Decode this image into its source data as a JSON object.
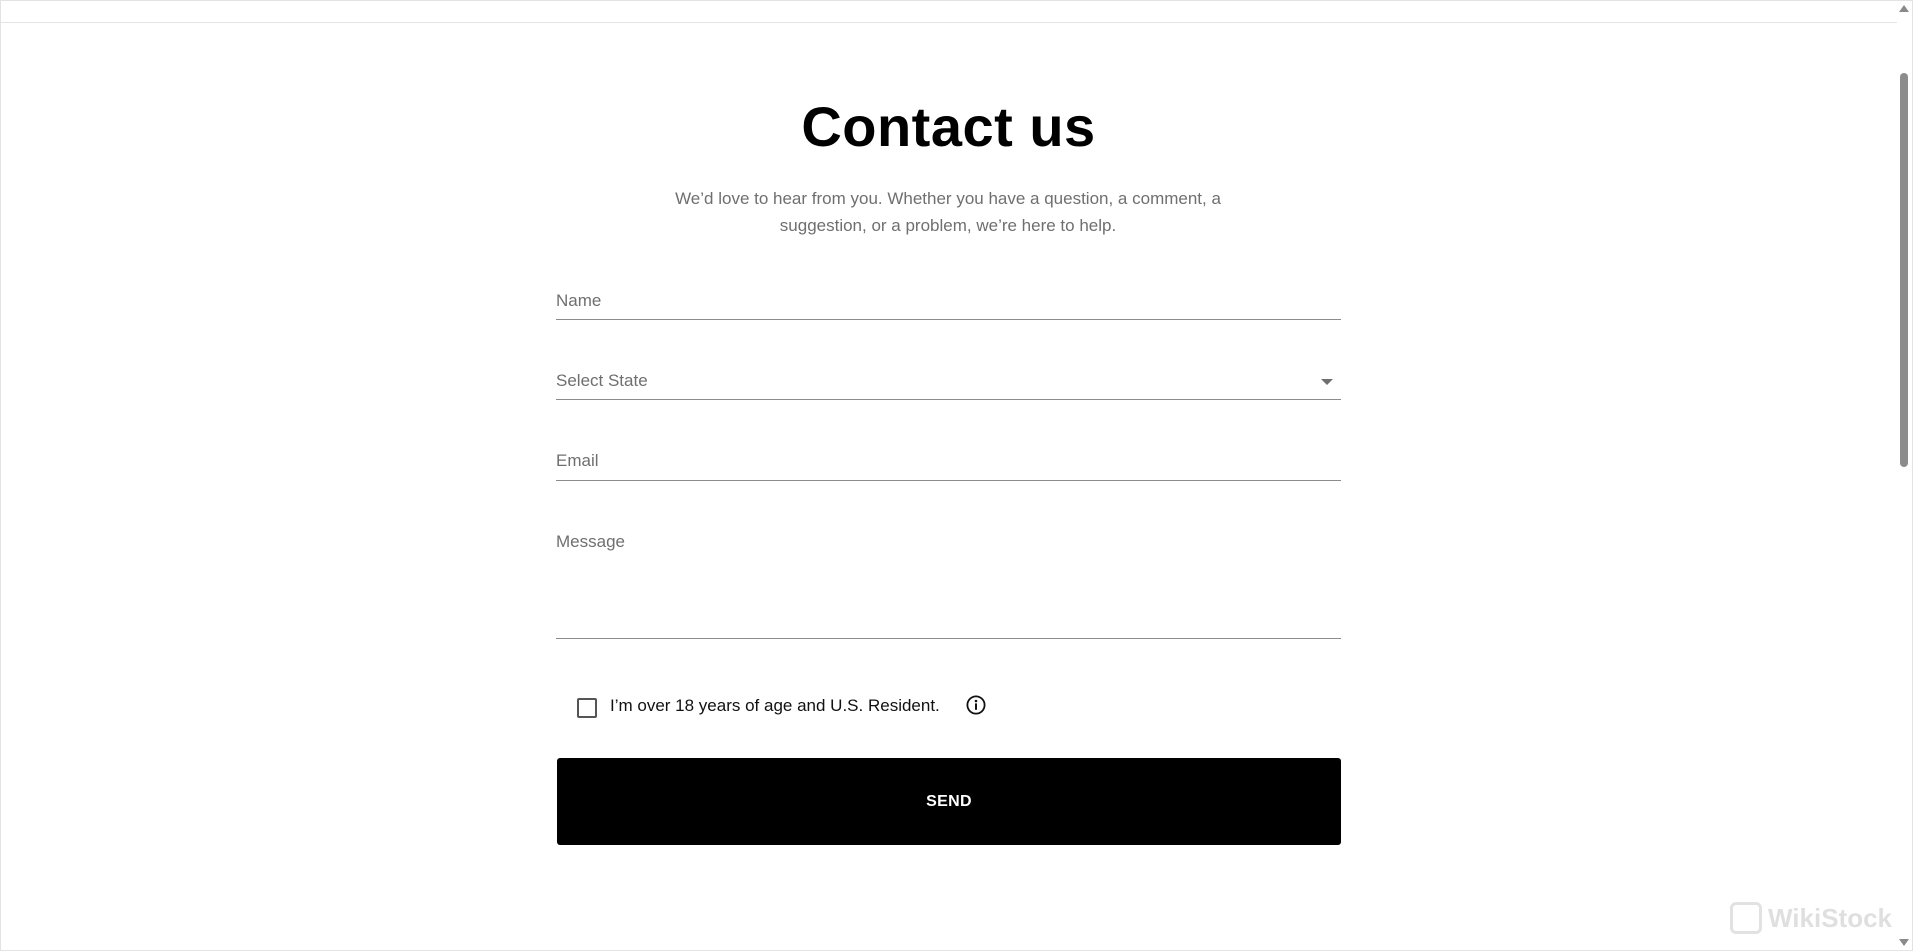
{
  "page": {
    "title": "Contact us",
    "subtitle": "We’d love to hear from you. Whether you have a question, a comment, a suggestion, or a problem, we’re here to help."
  },
  "form": {
    "name_placeholder": "Name",
    "state_placeholder": "Select State",
    "email_placeholder": "Email",
    "message_placeholder": "Message",
    "agree_label": "I’m over 18 years of age and U.S. Resident.",
    "agree_checked": false,
    "send_label": "SEND"
  },
  "watermark": {
    "text": "WikiStock"
  },
  "colors": {
    "accent": "#000000",
    "muted_text": "#6f6f6f",
    "underline": "#8b8b8b"
  },
  "icons": {
    "dropdown": "chevron-down-icon",
    "info": "info-icon",
    "checkbox": "checkbox-icon"
  }
}
